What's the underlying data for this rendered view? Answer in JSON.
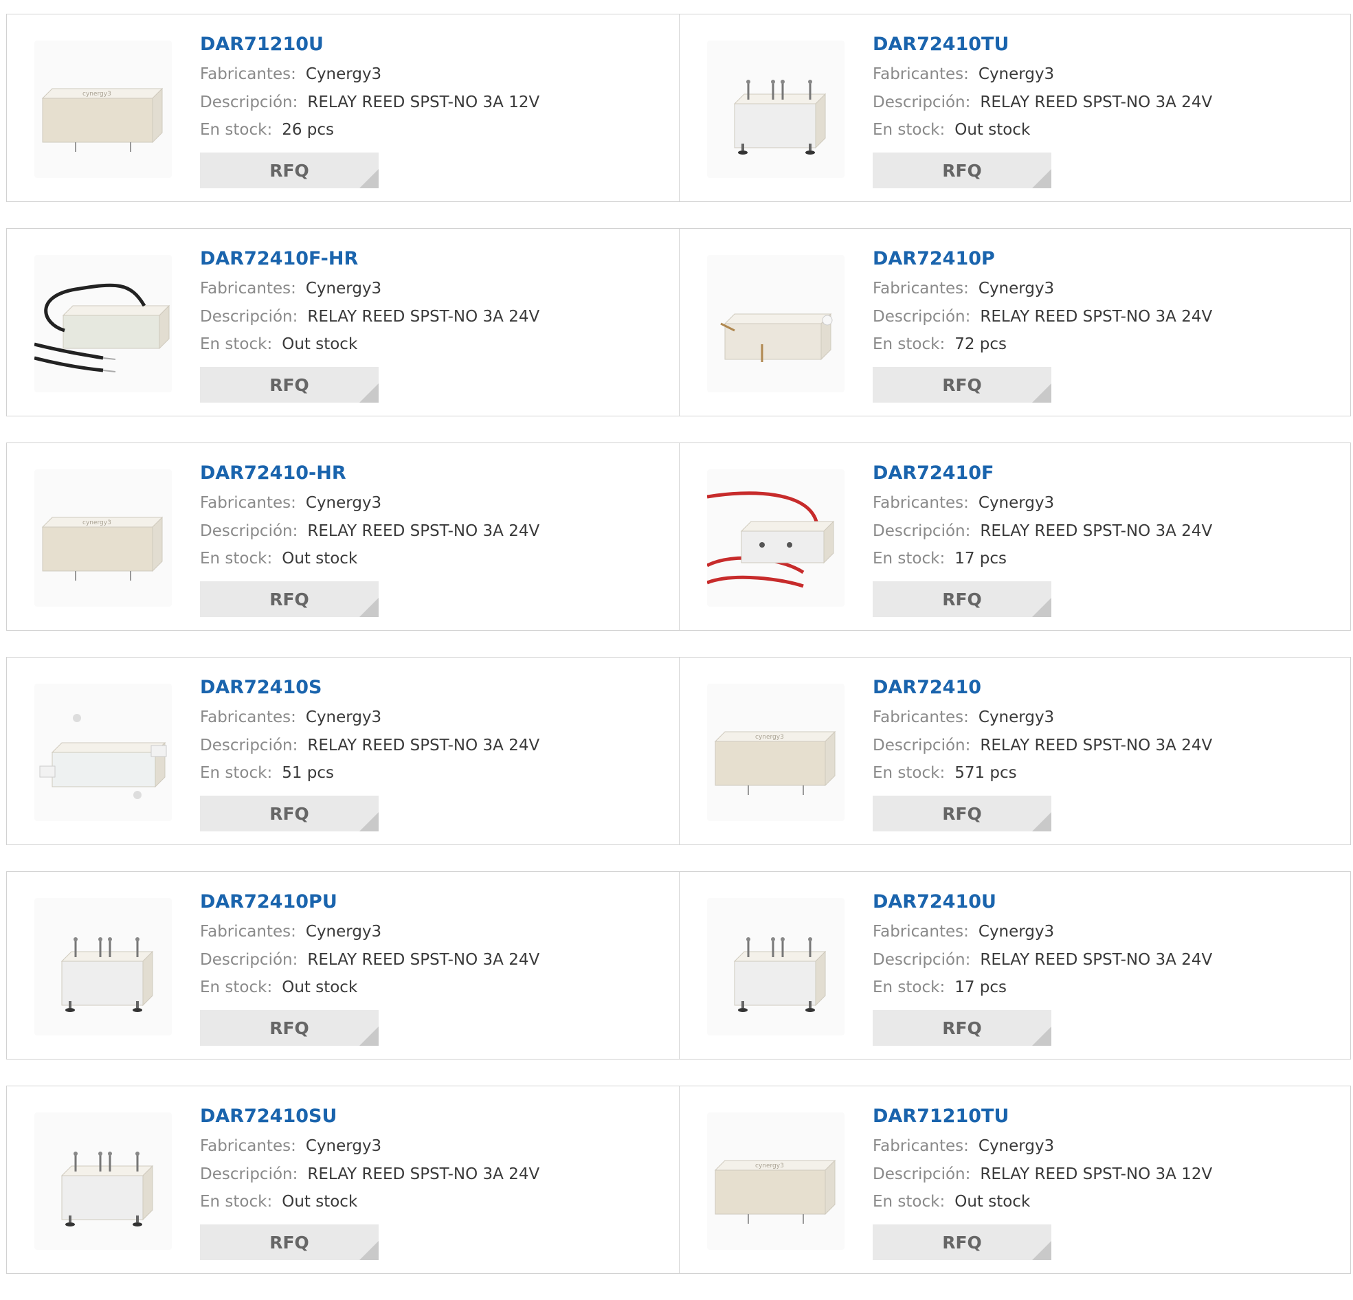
{
  "rfq_label": "RFQ",
  "labels": {
    "manufacturer": "Fabricantes:",
    "description": "Descripción:",
    "stock": "En stock:"
  },
  "rows": [
    [
      {
        "part": "DAR71210U",
        "manufacturer": "Cynergy3",
        "description": "RELAY REED SPST-NO 3A 12V",
        "stock": "26 pcs",
        "image": "reed-relay-beige"
      },
      {
        "part": "DAR72410TU",
        "manufacturer": "Cynergy3",
        "description": "RELAY REED SPST-NO 3A 24V",
        "stock": "Out stock",
        "image": "reed-relay-terminals"
      }
    ],
    [
      {
        "part": "DAR72410F-HR",
        "manufacturer": "Cynergy3",
        "description": "RELAY REED SPST-NO 3A 24V",
        "stock": "Out stock",
        "image": "reed-relay-black-leads"
      },
      {
        "part": "DAR72410P",
        "manufacturer": "Cynergy3",
        "description": "RELAY REED SPST-NO 3A 24V",
        "stock": "72 pcs",
        "image": "reed-relay-pins"
      }
    ],
    [
      {
        "part": "DAR72410-HR",
        "manufacturer": "Cynergy3",
        "description": "RELAY REED SPST-NO 3A 24V",
        "stock": "Out stock",
        "image": "reed-relay-beige"
      },
      {
        "part": "DAR72410F",
        "manufacturer": "Cynergy3",
        "description": "RELAY REED SPST-NO 3A 24V",
        "stock": "17 pcs",
        "image": "reed-relay-red-leads"
      }
    ],
    [
      {
        "part": "DAR72410S",
        "manufacturer": "Cynergy3",
        "description": "RELAY REED SPST-NO 3A 24V",
        "stock": "51 pcs",
        "image": "reed-relay-flange"
      },
      {
        "part": "DAR72410",
        "manufacturer": "Cynergy3",
        "description": "RELAY REED SPST-NO 3A 24V",
        "stock": "571 pcs",
        "image": "reed-relay-beige"
      }
    ],
    [
      {
        "part": "DAR72410PU",
        "manufacturer": "Cynergy3",
        "description": "RELAY REED SPST-NO 3A 24V",
        "stock": "Out stock",
        "image": "reed-relay-terminals"
      },
      {
        "part": "DAR72410U",
        "manufacturer": "Cynergy3",
        "description": "RELAY REED SPST-NO 3A 24V",
        "stock": "17 pcs",
        "image": "reed-relay-terminals"
      }
    ],
    [
      {
        "part": "DAR72410SU",
        "manufacturer": "Cynergy3",
        "description": "RELAY REED SPST-NO 3A 24V",
        "stock": "Out stock",
        "image": "reed-relay-terminals"
      },
      {
        "part": "DAR71210TU",
        "manufacturer": "Cynergy3",
        "description": "RELAY REED SPST-NO 3A 12V",
        "stock": "Out stock",
        "image": "reed-relay-beige"
      }
    ]
  ]
}
